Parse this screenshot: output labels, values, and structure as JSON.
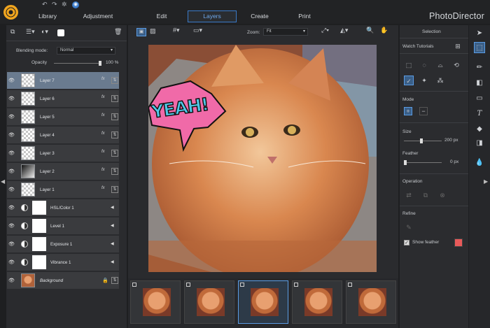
{
  "topbar": {
    "undo_icon": "undo-icon",
    "redo_icon": "redo-icon",
    "settings_icon": "gear-icon",
    "update_icon": "bell-icon",
    "tabs": [
      {
        "label": "Library"
      },
      {
        "label": "Adjustment"
      },
      {
        "label": "Edit"
      },
      {
        "label": "Layers"
      },
      {
        "label": "Create"
      },
      {
        "label": "Print"
      }
    ],
    "active_tab": "Layers",
    "brand": "PhotoDirector"
  },
  "left": {
    "blending_label": "Blending mode:",
    "blending_value": "Normal",
    "opacity_label": "Opacity",
    "opacity_value": "100 %",
    "opacity_fraction": 1.0,
    "layers": [
      {
        "name": "Layer 7",
        "fx": "fx",
        "selected": true
      },
      {
        "name": "Layer 6",
        "fx": "fx"
      },
      {
        "name": "Layer 5",
        "fx": "fx"
      },
      {
        "name": "Layer 4",
        "fx": "fx"
      },
      {
        "name": "Layer 3",
        "fx": "fx"
      },
      {
        "name": "Layer 2",
        "fx": "fx"
      },
      {
        "name": "Layer 1",
        "fx": "fx"
      }
    ],
    "adjustments": [
      {
        "name": "HSL/Color 1"
      },
      {
        "name": "Level 1"
      },
      {
        "name": "Exposure 1"
      },
      {
        "name": "Vibrance 1"
      }
    ],
    "background": "Background"
  },
  "center": {
    "zoom_label": "Zoom:",
    "zoom_value": "Fit",
    "canvas_text": "YEAH!"
  },
  "right": {
    "title": "Selection",
    "watch_tutorials": "Watch Tutorials",
    "mode_label": "Mode",
    "size_label": "Size",
    "size_value": "200 px",
    "size_fraction": 0.45,
    "feather_label": "Feather",
    "feather_value": "0 px",
    "feather_fraction": 0.0,
    "operation_label": "Operation",
    "refine_label": "Refine",
    "show_feather_label": "Show feather",
    "show_feather_checked": true,
    "feather_color": "#e85a5a"
  },
  "colors": {
    "accent": "#5b9ce4",
    "orange": "#f1a51e"
  }
}
